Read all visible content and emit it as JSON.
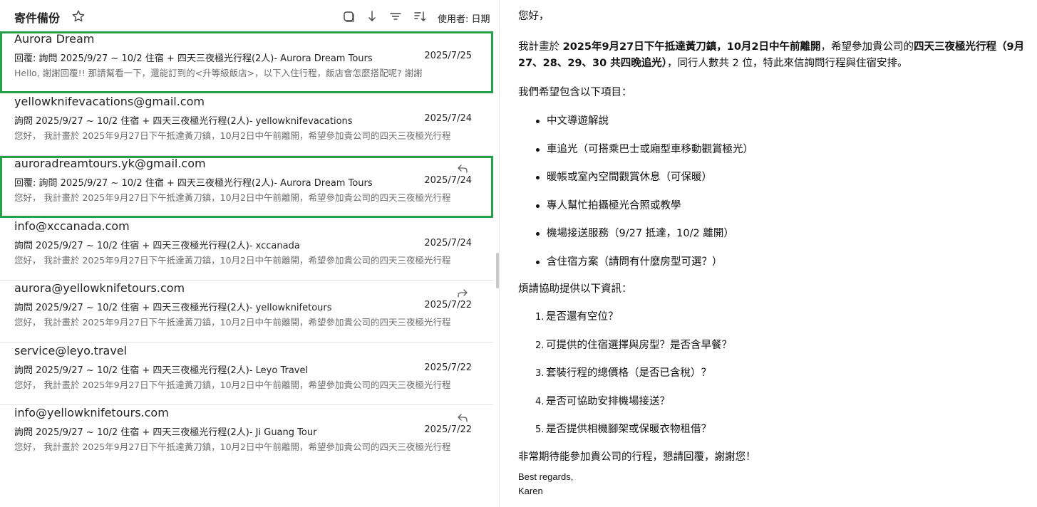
{
  "header": {
    "folder_title": "寄件備份",
    "sort_label": "使用者: 日期"
  },
  "messages": [
    {
      "sender": "Aurora Dream",
      "subject": "回覆: 詢問 2025/9/27 ~ 10/2 住宿 + 四天三夜極光行程(2人)- Aurora Dream Tours",
      "date": "2025/7/25",
      "preview": "Hello, 謝謝回覆!! 那請幫看一下，還能訂到的<升等級飯店>，以下入住行程，飯店會怎麼搭配呢? 謝謝",
      "icon": "",
      "selected": true
    },
    {
      "sender": "yellowknifevacations@gmail.com",
      "subject": "詢問 2025/9/27 ~ 10/2 住宿 + 四天三夜極光行程(2人)- yellowknifevacations",
      "date": "2025/7/24",
      "preview": "您好， 我計畫於 2025年9月27日下午抵達黃刀鎮，10月2日中午前離開，希望參加貴公司的四天三夜極光行程",
      "icon": "",
      "selected": false
    },
    {
      "sender": "auroradreamtours.yk@gmail.com",
      "subject": "回覆: 詢問 2025/9/27 ~ 10/2 住宿 + 四天三夜極光行程(2人)- Aurora Dream Tours",
      "date": "2025/7/24",
      "preview": "您好， 我計畫於 2025年9月27日下午抵達黃刀鎮，10月2日中午前離開，希望參加貴公司的四天三夜極光行程",
      "icon": "reply-icon",
      "selected": true
    },
    {
      "sender": "info@xccanada.com",
      "subject": "詢問 2025/9/27 ~ 10/2 住宿 + 四天三夜極光行程(2人)- xccanada",
      "date": "2025/7/24",
      "preview": "您好， 我計畫於 2025年9月27日下午抵達黃刀鎮，10月2日中午前離開，希望參加貴公司的四天三夜極光行程",
      "icon": "",
      "selected": false
    },
    {
      "sender": "aurora@yellowknifetours.com",
      "subject": "詢問 2025/9/27 ~ 10/2 住宿 + 四天三夜極光行程(2人)- yellowknifetours",
      "date": "2025/7/22",
      "preview": "您好， 我計畫於 2025年9月27日下午抵達黃刀鎮，10月2日中午前離開，希望參加貴公司的四天三夜極光行程",
      "icon": "forward-icon",
      "selected": false
    },
    {
      "sender": "service@leyo.travel",
      "subject": "詢問 2025/9/27 ~ 10/2 住宿 + 四天三夜極光行程(2人)- Leyo Travel",
      "date": "2025/7/22",
      "preview": "您好， 我計畫於 2025年9月27日下午抵達黃刀鎮，10月2日中午前離開，希望參加貴公司的四天三夜極光行程",
      "icon": "",
      "selected": false
    },
    {
      "sender": "info@yellowknifetours.com",
      "subject": "詢問 2025/9/27 ~ 10/2 住宿 + 四天三夜極光行程(2人)- Ji Guang Tour",
      "date": "2025/7/22",
      "preview": "您好， 我計畫於 2025年9月27日下午抵達黃刀鎮，10月2日中午前離開，希望參加貴公司的四天三夜極光行程",
      "icon": "reply-icon",
      "selected": false
    }
  ],
  "body": {
    "greeting": "您好，",
    "intro_1": "我計畫於 ",
    "intro_b1": "2025年9月27日下午抵達黃刀鎮，10月2日中午前離開",
    "intro_2": "，希望參加貴公司的",
    "intro_b2": "四天三夜極光行程（9月27、28、29、30 共四晚追光）",
    "intro_3": "，同行人數共 2 位，特此來信詢問行程與住宿安排。",
    "items_intro": "我們希望包含以下項目：",
    "items": [
      "中文導遊解說",
      "車追光（可搭乘巴士或廂型車移動觀賞極光）",
      "暖帳或室內空間觀賞休息（可保暖）",
      "專人幫忙拍攝極光合照或教學",
      "機場接送服務（9/27 抵達，10/2 離開）",
      "含住宿方案（請問有什麼房型可選？）"
    ],
    "info_intro": "煩請協助提供以下資訊：",
    "questions": [
      "是否還有空位？",
      "可提供的住宿選擇與房型？是否含早餐？",
      "套裝行程的總價格（是否已含稅）？",
      "是否可協助安排機場接送？",
      "是否提供相機腳架或保暖衣物租借？"
    ],
    "closing": "非常期待能參加貴公司的行程，懇請回覆，謝謝您！",
    "regards": "Best regards,",
    "signature": "Karen"
  },
  "colors": {
    "selection_outline": "#27a149",
    "preview_text": "#6e6e6e"
  }
}
